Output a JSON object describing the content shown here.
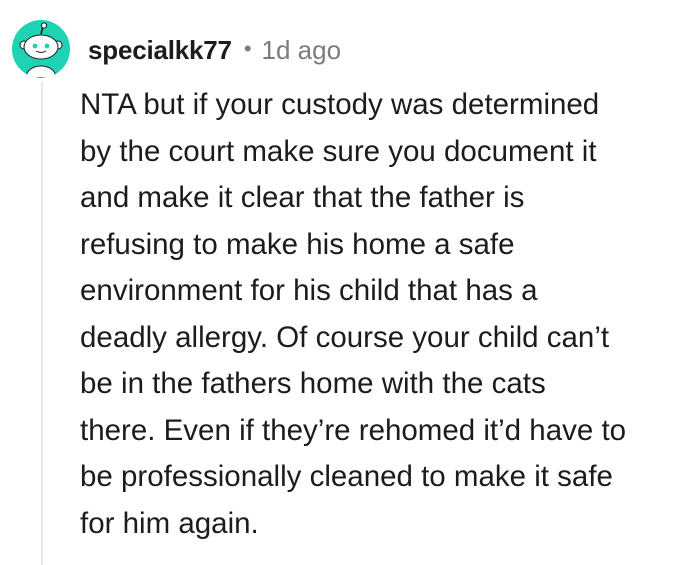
{
  "comment": {
    "author": {
      "username": "specialkk77",
      "avatar_icon": "snoo-avatar-icon",
      "avatar_color": "#1fd2b3"
    },
    "separator": "•",
    "timestamp": "1d ago",
    "body_lines": [
      "NTA but if your custody was determined",
      "by the court make sure you document it",
      "and make it clear that the father is",
      "refusing to make his home a safe",
      "environment for his child that has a",
      "deadly allergy. Of course your child can’t",
      "be in the fathers home with the cats",
      "there. Even if they’re rehomed it’d have to",
      "be professionally cleaned to make it safe",
      "for him again."
    ]
  }
}
